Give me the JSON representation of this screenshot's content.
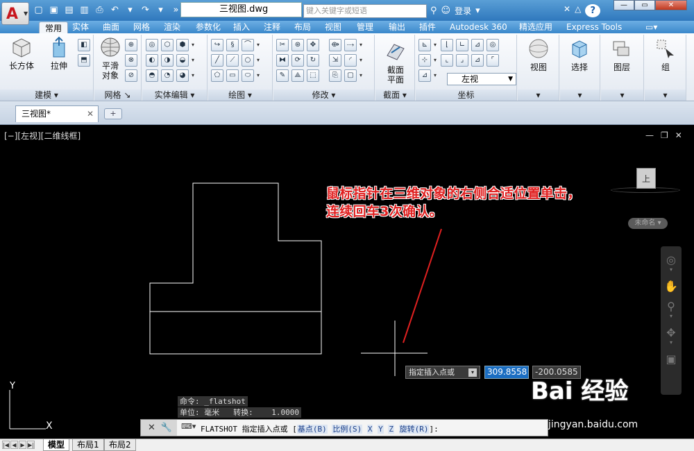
{
  "titlebar": {
    "doc_title": "三视图.dwg",
    "search_placeholder": "键入关键字或短语",
    "signin": "登录"
  },
  "ribbon_tabs": [
    "常用",
    "实体",
    "曲面",
    "网格",
    "渲染",
    "参数化",
    "插入",
    "注释",
    "布局",
    "视图",
    "管理",
    "输出",
    "插件",
    "Autodesk 360",
    "精选应用",
    "Express Tools"
  ],
  "active_tab": "常用",
  "panels": {
    "modeling": {
      "title": "建模",
      "box": "长方体",
      "extrude": "拉伸"
    },
    "mesh": {
      "title": "网格",
      "smooth": "平滑\n对象"
    },
    "solid_edit": {
      "title": "实体编辑"
    },
    "draw": {
      "title": "绘图"
    },
    "modify": {
      "title": "修改"
    },
    "section": {
      "title": "截面",
      "section_plane": "截面\n平面"
    },
    "coords": {
      "title": "坐标",
      "view_combo": "左视"
    },
    "view": {
      "label": "视图"
    },
    "selection": {
      "label": "选择"
    },
    "layers": {
      "label": "图层"
    },
    "groups": {
      "label": "组"
    }
  },
  "file_tab": {
    "name": "三视图*"
  },
  "viewport_label": "[−][左视][二维线框]",
  "viewcube": {
    "face": "上",
    "unnamed": "未命名"
  },
  "annotation": {
    "line1": "鼠标指针在三维对象的右侧合适位置单击，",
    "line2": "连续回车3次确认。"
  },
  "dynamic_input": {
    "prompt": "指定插入点或",
    "x": "309.8558",
    "y": "-200.0585"
  },
  "command_history": {
    "line1": "命令: _flatshot",
    "line2": "单位: 毫米   转换:    1.0000"
  },
  "command_line": {
    "command": "FLATSHOT 指定插入点或 [",
    "opt_base": "基点(B)",
    "opt_scale": "比例(S)",
    "opt_x": "X",
    "opt_y": "Y",
    "opt_z": "Z",
    "opt_rotate": "旋转(R)",
    "end": "]:"
  },
  "ucs": {
    "y": "Y",
    "x": "X"
  },
  "layout_tabs": [
    "模型",
    "布局1",
    "布局2"
  ],
  "watermark": {
    "brand": "Bai 经验",
    "url": "jingyan.baidu.com"
  }
}
